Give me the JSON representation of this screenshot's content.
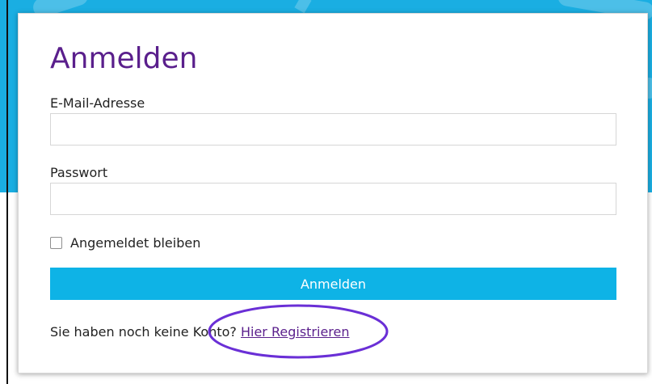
{
  "form": {
    "title": "Anmelden",
    "email_label": "E-Mail-Adresse",
    "email_value": "",
    "password_label": "Passwort",
    "password_value": "",
    "remember_label": "Angemeldet bleiben",
    "remember_checked": false,
    "submit_label": "Anmelden",
    "register_prompt": "Sie haben noch keine Konto?",
    "register_link": "Hier Registrieren"
  },
  "colors": {
    "title": "#5a1f8c",
    "link": "#5a1f8c",
    "submit_bg": "#0eb3e6",
    "banner": "#1aaee2",
    "highlight": "#6a2fd6"
  }
}
